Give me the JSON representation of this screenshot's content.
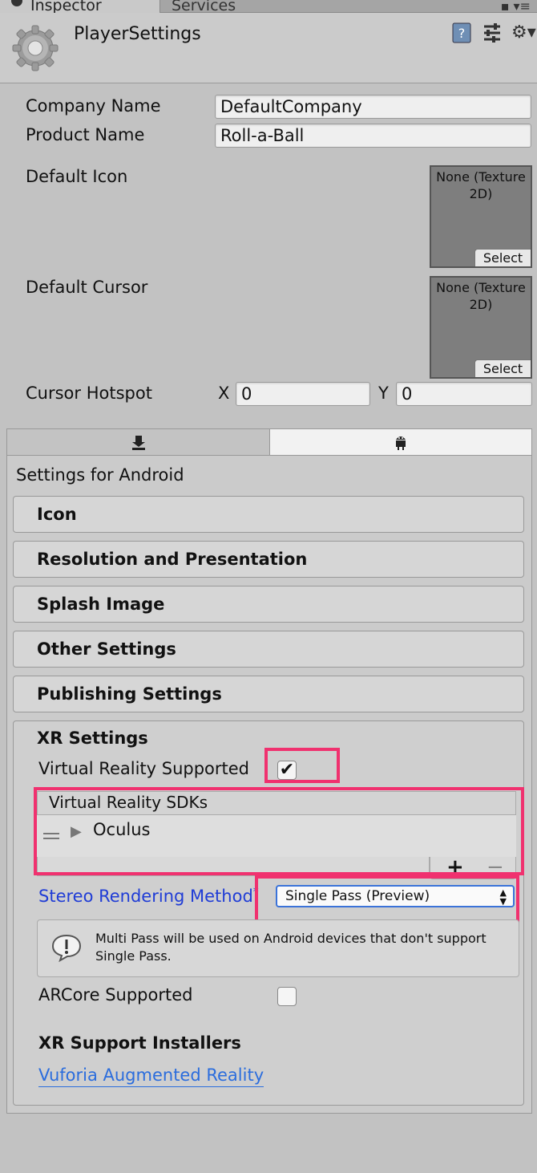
{
  "tabs": {
    "inspector": "Inspector",
    "services": "Services"
  },
  "header": {
    "title": "PlayerSettings"
  },
  "fields": {
    "company_name_label": "Company Name",
    "company_name_value": "DefaultCompany",
    "product_name_label": "Product Name",
    "product_name_value": "Roll-a-Ball",
    "default_icon_label": "Default Icon",
    "default_cursor_label": "Default Cursor",
    "texture_none_line1": "None (Texture",
    "texture_none_line2": "2D)",
    "select_label": "Select",
    "cursor_hotspot_label": "Cursor Hotspot",
    "hotspot_x_label": "X",
    "hotspot_x_value": "0",
    "hotspot_y_label": "Y",
    "hotspot_y_value": "0"
  },
  "platform": {
    "settings_for": "Settings for Android",
    "sections": [
      "Icon",
      "Resolution and Presentation",
      "Splash Image",
      "Other Settings",
      "Publishing Settings"
    ]
  },
  "xr": {
    "title": "XR Settings",
    "vr_supported_label": "Virtual Reality Supported",
    "vr_supported_checked": true,
    "vr_sdks_label": "Virtual Reality SDKs",
    "sdk_items": [
      "Oculus"
    ],
    "add_symbol": "+",
    "remove_symbol": "−",
    "stereo_label": "Stereo Rendering Method",
    "stereo_asterisk": "*",
    "stereo_value": "Single Pass (Preview)",
    "help_text": "Multi Pass will be used on Android devices that don't support Single Pass.",
    "arcore_label": "ARCore Supported",
    "arcore_checked": false,
    "installers_title": "XR Support Installers",
    "vuforia_link": "Vuforia Augmented Reality"
  },
  "colors": {
    "highlight": "#f0316f",
    "link": "#2b6ddd",
    "modified_label": "#1f3cd6"
  }
}
